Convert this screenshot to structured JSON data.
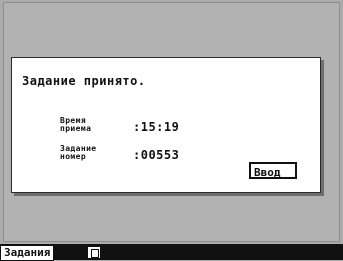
{
  "dialog": {
    "title": "Задание принято.",
    "fields": [
      {
        "label": "Время\nприема",
        "value": ":15:19"
      },
      {
        "label": "Задание\nномер",
        "value": ":00553"
      }
    ],
    "enter_button": "Ввод"
  },
  "taskbar": {
    "tab_label": "Задания",
    "icon": "document-icon"
  },
  "colors": {
    "screen_background": "#ababab",
    "dialog_background": "#ffffff",
    "taskbar_background": "#111111"
  }
}
